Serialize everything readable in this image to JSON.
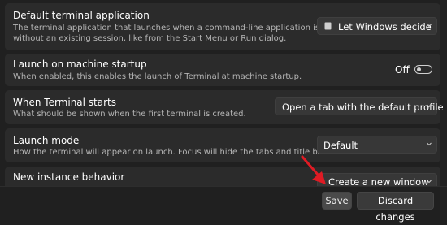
{
  "settings": [
    {
      "title": "Default terminal application",
      "description": "The terminal application that launches when a command-line application is run\nwithout an existing session, like from the Start Menu or Run dialog.",
      "value": "Let Windows decide",
      "value_icon": "terminal-app-icon"
    },
    {
      "title": "Launch on machine startup",
      "description": "When enabled, this enables the launch of Terminal at machine startup.",
      "toggle_label": "Off",
      "toggle_on": false
    },
    {
      "title": "When Terminal starts",
      "description": "What should be shown when the first terminal is created.",
      "value": "Open a tab with the default profile"
    },
    {
      "title": "Launch mode",
      "description": "How the terminal will appear on launch. Focus will hide the tabs and title bar.",
      "value": "Default"
    },
    {
      "title": "New instance behavior",
      "value": "Create a new window"
    }
  ],
  "footer": {
    "save_label": "Save",
    "discard_label": "Discard changes"
  },
  "colors": {
    "background": "#202020",
    "card": "#2b2b2b",
    "annotation_arrow": "#e01b24"
  }
}
